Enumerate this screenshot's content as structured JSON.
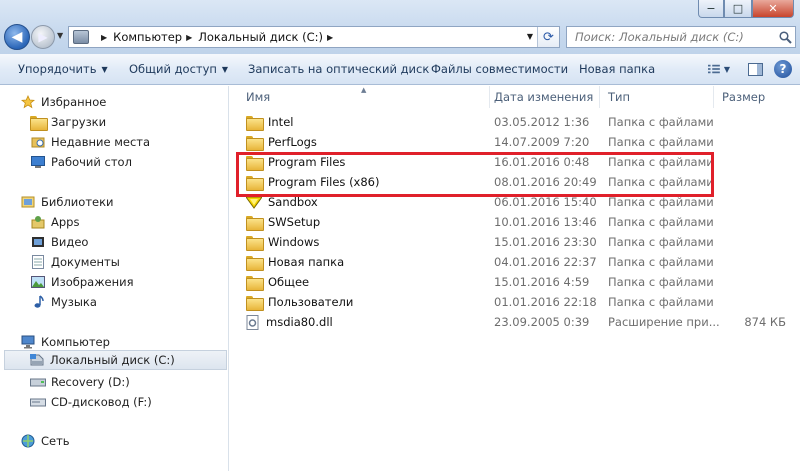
{
  "window": {
    "min_label": "−",
    "max_label": "□",
    "close_label": "✕"
  },
  "address": {
    "crumbs": [
      "Компьютер",
      "Локальный диск (C:)"
    ]
  },
  "search": {
    "placeholder": "Поиск: Локальный диск (C:)"
  },
  "toolbar": {
    "organize": "Упорядочить",
    "share": "Общий доступ",
    "burn": "Записать на оптический диск",
    "compat": "Файлы совместимости",
    "new_folder": "Новая папка"
  },
  "nav": {
    "favorites": "Избранное",
    "downloads": "Загрузки",
    "recent": "Недавние места",
    "desktop": "Рабочий стол",
    "libraries": "Библиотеки",
    "apps": "Apps",
    "video": "Видео",
    "documents": "Документы",
    "images": "Изображения",
    "music": "Музыка",
    "computer": "Компьютер",
    "local_disk": "Локальный диск (C:)",
    "recovery": "Recovery (D:)",
    "cd": "CD-дисковод (F:)",
    "network": "Сеть"
  },
  "columns": {
    "name": "Имя",
    "date": "Дата изменения",
    "type": "Тип",
    "size": "Размер"
  },
  "files": [
    {
      "name": "Intel",
      "date": "03.05.2012 1:36",
      "type": "Папка с файлами",
      "size": "",
      "icon": "folder"
    },
    {
      "name": "PerfLogs",
      "date": "14.07.2009 7:20",
      "type": "Папка с файлами",
      "size": "",
      "icon": "folder"
    },
    {
      "name": "Program Files",
      "date": "16.01.2016 0:48",
      "type": "Папка с файлами",
      "size": "",
      "icon": "folder"
    },
    {
      "name": "Program Files (x86)",
      "date": "08.01.2016 20:49",
      "type": "Папка с файлами",
      "size": "",
      "icon": "folder"
    },
    {
      "name": "Sandbox",
      "date": "06.01.2016 15:40",
      "type": "Папка с файлами",
      "size": "",
      "icon": "sandbox"
    },
    {
      "name": "SWSetup",
      "date": "10.01.2016 13:46",
      "type": "Папка с файлами",
      "size": "",
      "icon": "folder"
    },
    {
      "name": "Windows",
      "date": "15.01.2016 23:30",
      "type": "Папка с файлами",
      "size": "",
      "icon": "folder"
    },
    {
      "name": "Новая папка",
      "date": "04.01.2016 22:37",
      "type": "Папка с файлами",
      "size": "",
      "icon": "folder"
    },
    {
      "name": "Общее",
      "date": "15.01.2016 4:59",
      "type": "Папка с файлами",
      "size": "",
      "icon": "folder"
    },
    {
      "name": "Пользователи",
      "date": "01.01.2016 22:18",
      "type": "Папка с файлами",
      "size": "",
      "icon": "folder"
    },
    {
      "name": "msdia80.dll",
      "date": "23.09.2005 0:39",
      "type": "Расширение при...",
      "size": "874 КБ",
      "icon": "dll"
    }
  ],
  "colors": {
    "highlight": "#e0202a",
    "accent": "#1e395b"
  }
}
